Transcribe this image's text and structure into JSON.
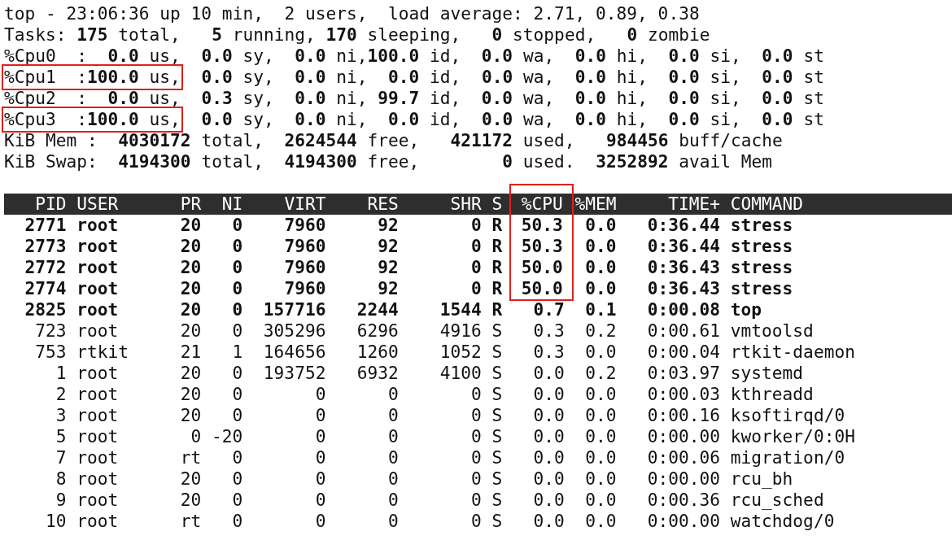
{
  "summary": {
    "uptime_line": "top - 23:06:36 up 10 min,  2 users,  load average: 2.71, 0.89, 0.38",
    "tasks_line": "Tasks: **175** total,   **5** running, **170** sleeping,   **0** stopped,   **0** zombie",
    "cpu_lines": [
      {
        "head": "%Cpu0  :  **0.0** us,",
        "rest": "  **0.0** sy,  **0.0** ni,**100.0** id,  **0.0** wa,  **0.0** hi,  **0.0** si,  **0.0** st",
        "boxed": false
      },
      {
        "head": "%Cpu1  :**100.0** us,",
        "rest": "  **0.0** sy,  **0.0** ni,  **0.0** id,  **0.0** wa,  **0.0** hi,  **0.0** si,  **0.0** st",
        "boxed": true
      },
      {
        "head": "%Cpu2  :  **0.0** us,",
        "rest": "  **0.3** sy,  **0.0** ni, **99.7** id,  **0.0** wa,  **0.0** hi,  **0.0** si,  **0.0** st",
        "boxed": false
      },
      {
        "head": "%Cpu3  :**100.0** us,",
        "rest": "  **0.0** sy,  **0.0** ni,  **0.0** id,  **0.0** wa,  **0.0** hi,  **0.0** si,  **0.0** st",
        "boxed": true
      }
    ],
    "mem_line": "KiB Mem :  **4030172** total,  **2624544** free,   **421172** used,   **984456** buff/cache",
    "swap_line": "KiB Swap:  **4194300** total,  **4194300** free,        **0** used.  **3252892** avail Mem"
  },
  "process_table": {
    "columns": [
      "PID",
      "USER",
      "PR",
      "NI",
      "VIRT",
      "RES",
      "SHR",
      "S",
      "%CPU",
      "%MEM",
      "TIME+",
      "COMMAND"
    ],
    "rows": [
      {
        "cells": [
          "2771",
          "root",
          "20",
          "0",
          "7960",
          "92",
          "0",
          "R",
          "50.3",
          "0.0",
          "0:36.44",
          "stress"
        ],
        "bold": true,
        "cpu_boxed": true
      },
      {
        "cells": [
          "2773",
          "root",
          "20",
          "0",
          "7960",
          "92",
          "0",
          "R",
          "50.3",
          "0.0",
          "0:36.44",
          "stress"
        ],
        "bold": true,
        "cpu_boxed": true
      },
      {
        "cells": [
          "2772",
          "root",
          "20",
          "0",
          "7960",
          "92",
          "0",
          "R",
          "50.0",
          "0.0",
          "0:36.43",
          "stress"
        ],
        "bold": true,
        "cpu_boxed": true
      },
      {
        "cells": [
          "2774",
          "root",
          "20",
          "0",
          "7960",
          "92",
          "0",
          "R",
          "50.0",
          "0.0",
          "0:36.43",
          "stress"
        ],
        "bold": true,
        "cpu_boxed": true
      },
      {
        "cells": [
          "2825",
          "root",
          "20",
          "0",
          "157716",
          "2244",
          "1544",
          "R",
          "0.7",
          "0.1",
          "0:00.08",
          "top"
        ],
        "bold": true,
        "cpu_boxed": false
      },
      {
        "cells": [
          "723",
          "root",
          "20",
          "0",
          "305296",
          "6296",
          "4916",
          "S",
          "0.3",
          "0.2",
          "0:00.61",
          "vmtoolsd"
        ],
        "bold": false,
        "cpu_boxed": false
      },
      {
        "cells": [
          "753",
          "rtkit",
          "21",
          "1",
          "164656",
          "1260",
          "1052",
          "S",
          "0.3",
          "0.0",
          "0:00.04",
          "rtkit-daemon"
        ],
        "bold": false,
        "cpu_boxed": false
      },
      {
        "cells": [
          "1",
          "root",
          "20",
          "0",
          "193752",
          "6932",
          "4100",
          "S",
          "0.0",
          "0.2",
          "0:03.97",
          "systemd"
        ],
        "bold": false,
        "cpu_boxed": false
      },
      {
        "cells": [
          "2",
          "root",
          "20",
          "0",
          "0",
          "0",
          "0",
          "S",
          "0.0",
          "0.0",
          "0:00.03",
          "kthreadd"
        ],
        "bold": false,
        "cpu_boxed": false
      },
      {
        "cells": [
          "3",
          "root",
          "20",
          "0",
          "0",
          "0",
          "0",
          "S",
          "0.0",
          "0.0",
          "0:00.16",
          "ksoftirqd/0"
        ],
        "bold": false,
        "cpu_boxed": false
      },
      {
        "cells": [
          "5",
          "root",
          "0",
          "-20",
          "0",
          "0",
          "0",
          "S",
          "0.0",
          "0.0",
          "0:00.00",
          "kworker/0:0H"
        ],
        "bold": false,
        "cpu_boxed": false
      },
      {
        "cells": [
          "7",
          "root",
          "rt",
          "0",
          "0",
          "0",
          "0",
          "S",
          "0.0",
          "0.0",
          "0:00.06",
          "migration/0"
        ],
        "bold": false,
        "cpu_boxed": false
      },
      {
        "cells": [
          "8",
          "root",
          "20",
          "0",
          "0",
          "0",
          "0",
          "S",
          "0.0",
          "0.0",
          "0:00.00",
          "rcu_bh"
        ],
        "bold": false,
        "cpu_boxed": false
      },
      {
        "cells": [
          "9",
          "root",
          "20",
          "0",
          "0",
          "0",
          "0",
          "S",
          "0.0",
          "0.0",
          "0:00.36",
          "rcu_sched"
        ],
        "bold": false,
        "cpu_boxed": false
      },
      {
        "cells": [
          "10",
          "root",
          "rt",
          "0",
          "0",
          "0",
          "0",
          "S",
          "0.0",
          "0.0",
          "0:00.00",
          "watchdog/0"
        ],
        "bold": false,
        "cpu_boxed": false
      }
    ]
  }
}
